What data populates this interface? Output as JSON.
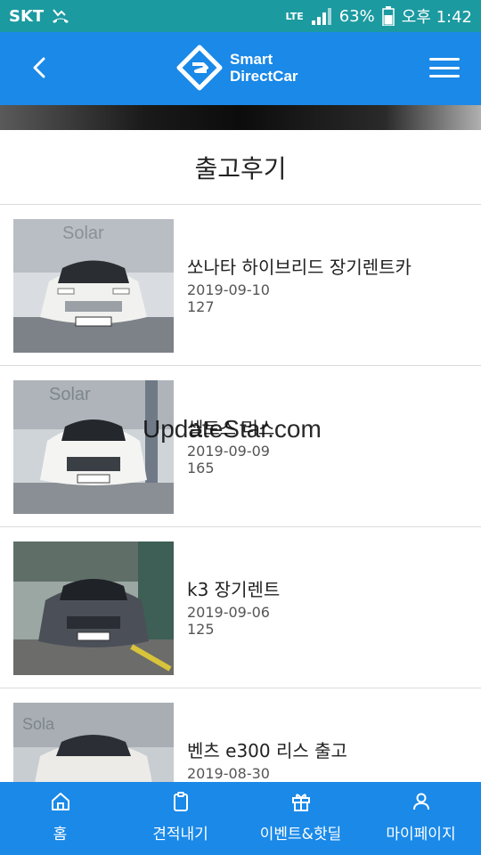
{
  "status_bar": {
    "carrier": "SKT",
    "network": "LTE",
    "battery": "63%",
    "time": "오후 1:42"
  },
  "header": {
    "brand_line1": "Smart",
    "brand_line2": "DirectCar"
  },
  "page": {
    "title": "출고후기"
  },
  "items": [
    {
      "title": "쏘나타 하이브리드 장기렌트카",
      "date": "2019-09-10",
      "count": "127"
    },
    {
      "title": "셀토스 리스",
      "date": "2019-09-09",
      "count": "165"
    },
    {
      "title": "k3 장기렌트",
      "date": "2019-09-06",
      "count": "125"
    },
    {
      "title": "벤츠 e300 리스 출고",
      "date": "2019-08-30",
      "count": ""
    }
  ],
  "watermark": "UpdateStar.com",
  "bottom_nav": [
    {
      "label": "홈",
      "icon": "home-icon"
    },
    {
      "label": "견적내기",
      "icon": "clipboard-icon"
    },
    {
      "label": "이벤트&핫딜",
      "icon": "gift-icon"
    },
    {
      "label": "마이페이지",
      "icon": "user-icon"
    }
  ],
  "colors": {
    "status_bar": "#1b9aa0",
    "primary": "#1a89e8"
  }
}
